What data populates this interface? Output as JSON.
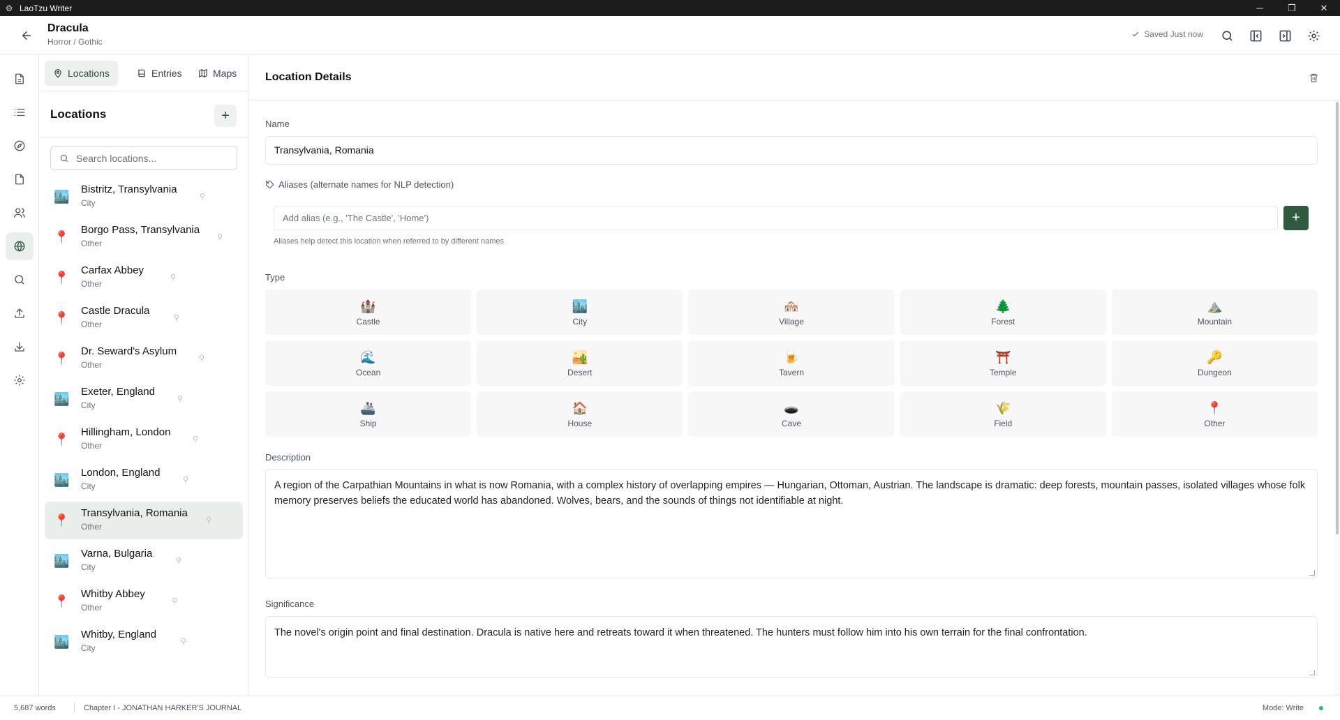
{
  "window": {
    "app_title": "LaoTzu Writer",
    "controls": [
      "─",
      "❐",
      "✕"
    ]
  },
  "header": {
    "doc_title": "Dracula",
    "doc_genre": "Horror / Gothic",
    "saved_status": "Saved Just now",
    "icons": [
      "search-icon",
      "collapse-left-panel-icon",
      "collapse-right-panel-icon",
      "settings-icon"
    ]
  },
  "rail": {
    "items": [
      "document-icon",
      "list-icon",
      "compass-icon",
      "file-icon",
      "users-icon",
      "globe-icon",
      "search-icon",
      "upload-icon",
      "download-icon",
      "settings-icon"
    ],
    "active": "globe-icon"
  },
  "panel": {
    "tabs": [
      {
        "label": "Locations",
        "icon": "map-pin-icon",
        "active": true
      },
      {
        "label": "Entries",
        "icon": "book-icon",
        "active": false
      },
      {
        "label": "Maps",
        "icon": "map-icon",
        "active": false
      }
    ],
    "title": "Locations",
    "add_symbol": "+",
    "search_placeholder": "Search locations...",
    "locations": [
      {
        "name": "Bistritz, Transylvania",
        "type": "City",
        "emoji": "🏙️",
        "selected": false
      },
      {
        "name": "Borgo Pass, Transylvania",
        "type": "Other",
        "emoji": "📍",
        "selected": false
      },
      {
        "name": "Carfax Abbey",
        "type": "Other",
        "emoji": "📍",
        "selected": false
      },
      {
        "name": "Castle Dracula",
        "type": "Other",
        "emoji": "📍",
        "selected": false
      },
      {
        "name": "Dr. Seward's Asylum",
        "type": "Other",
        "emoji": "📍",
        "selected": false
      },
      {
        "name": "Exeter, England",
        "type": "City",
        "emoji": "🏙️",
        "selected": false
      },
      {
        "name": "Hillingham, London",
        "type": "Other",
        "emoji": "📍",
        "selected": false
      },
      {
        "name": "London, England",
        "type": "City",
        "emoji": "🏙️",
        "selected": false
      },
      {
        "name": "Transylvania, Romania",
        "type": "Other",
        "emoji": "📍",
        "selected": true
      },
      {
        "name": "Varna, Bulgaria",
        "type": "City",
        "emoji": "🏙️",
        "selected": false
      },
      {
        "name": "Whitby Abbey",
        "type": "Other",
        "emoji": "📍",
        "selected": false
      },
      {
        "name": "Whitby, England",
        "type": "City",
        "emoji": "🏙️",
        "selected": false
      }
    ],
    "pin_glyph": "⚲"
  },
  "details": {
    "title": "Location Details",
    "name_label": "Name",
    "name_value": "Transylvania, Romania",
    "aliases_label": "Aliases (alternate names for NLP detection)",
    "alias_placeholder": "Add alias (e.g., 'The Castle', 'Home')",
    "alias_add_symbol": "+",
    "alias_help": "Aliases help detect this location when referred to by different names",
    "type_label": "Type",
    "types": [
      {
        "label": "Castle",
        "emoji": "🏰"
      },
      {
        "label": "City",
        "emoji": "🏙️"
      },
      {
        "label": "Village",
        "emoji": "🏘️"
      },
      {
        "label": "Forest",
        "emoji": "🌲"
      },
      {
        "label": "Mountain",
        "emoji": "⛰️"
      },
      {
        "label": "Ocean",
        "emoji": "🌊"
      },
      {
        "label": "Desert",
        "emoji": "🏜️"
      },
      {
        "label": "Tavern",
        "emoji": "🍺"
      },
      {
        "label": "Temple",
        "emoji": "⛩️"
      },
      {
        "label": "Dungeon",
        "emoji": "🔑"
      },
      {
        "label": "Ship",
        "emoji": "🚢"
      },
      {
        "label": "House",
        "emoji": "🏠"
      },
      {
        "label": "Cave",
        "emoji": "🕳️"
      },
      {
        "label": "Field",
        "emoji": "🌾"
      },
      {
        "label": "Other",
        "emoji": "📍"
      }
    ],
    "description_label": "Description",
    "description_value": "A region of the Carpathian Mountains in what is now Romania, with a complex history of overlapping empires — Hungarian, Ottoman, Austrian. The landscape is dramatic: deep forests, mountain passes, isolated villages whose folk memory preserves beliefs the educated world has abandoned. Wolves, bears, and the sounds of things not identifiable at night.",
    "significance_label": "Significance",
    "significance_value": "The novel's origin point and final destination. Dracula is native here and retreats toward it when threatened. The hunters must follow him into his own terrain for the final confrontation."
  },
  "status": {
    "words": "5,687 words",
    "chapter": "Chapter I - JONATHAN HARKER'S JOURNAL",
    "mode": "Mode: Write",
    "dot_color": "#22c55e"
  },
  "colors": {
    "accent": "#2f5a3f",
    "selected_bg": "#e9eeea",
    "border": "#e5e7eb"
  }
}
